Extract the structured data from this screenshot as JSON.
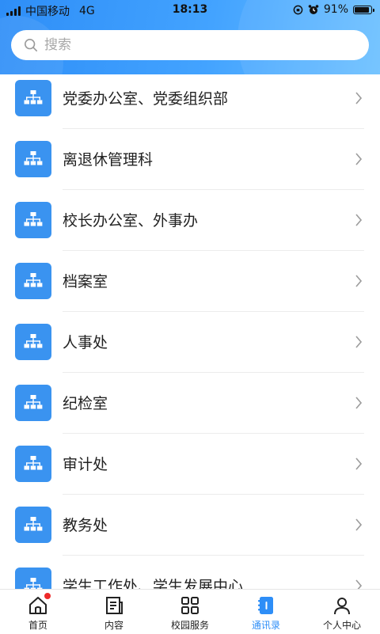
{
  "status_bar": {
    "carrier": "中国移动",
    "network": "4G",
    "time": "18:13",
    "battery_percent": "91%",
    "battery_level": 0.91
  },
  "search": {
    "placeholder": "搜索",
    "value": ""
  },
  "departments": [
    {
      "label": "党委办公室、党委组织部"
    },
    {
      "label": "离退休管理科"
    },
    {
      "label": "校长办公室、外事办"
    },
    {
      "label": "档案室"
    },
    {
      "label": "人事处"
    },
    {
      "label": "纪检室"
    },
    {
      "label": "审计处"
    },
    {
      "label": "教务处"
    },
    {
      "label": "学生工作处、学生发展中心"
    }
  ],
  "tabbar": {
    "tabs": [
      {
        "label": "首页",
        "icon": "home-icon",
        "has_badge": true
      },
      {
        "label": "内容",
        "icon": "document-icon"
      },
      {
        "label": "校园服务",
        "icon": "grid-icon"
      },
      {
        "label": "通讯录",
        "icon": "address-book-icon",
        "active": true
      },
      {
        "label": "个人中心",
        "icon": "user-icon"
      }
    ]
  },
  "colors": {
    "accent": "#2e8ef7",
    "org_icon_bg": "#3a93f0",
    "badge": "#ee2a2a"
  }
}
